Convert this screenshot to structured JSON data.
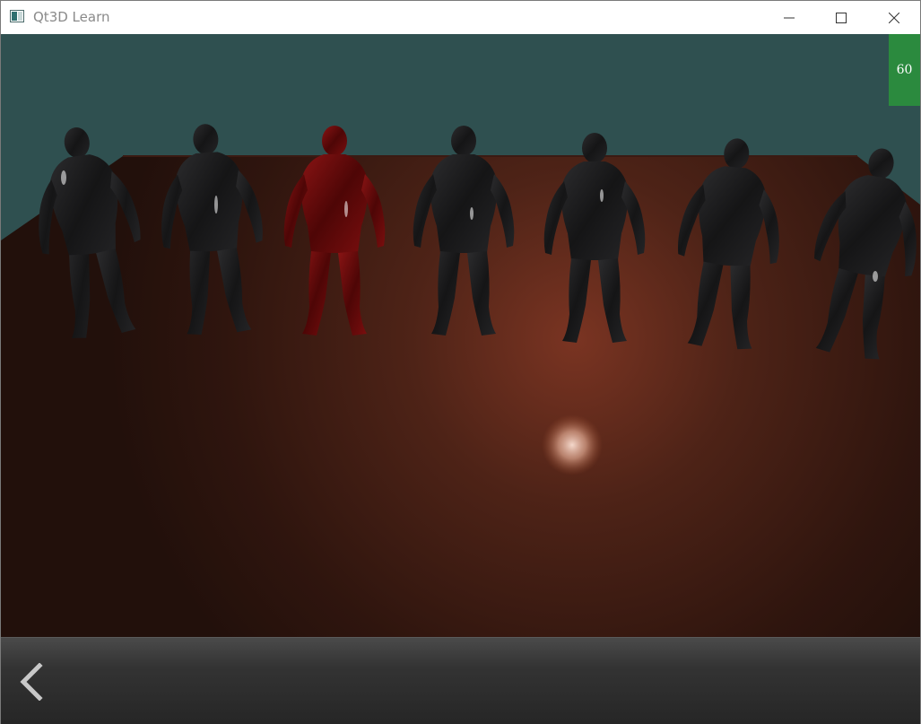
{
  "window": {
    "title": "Qt3D Learn",
    "app_icon": "qt-window-icon",
    "controls": {
      "minimize_icon": "minimize-icon",
      "maximize_icon": "maximize-icon",
      "close_icon": "close-icon"
    }
  },
  "viewport": {
    "fps": "60",
    "background_color": "#2f5050",
    "floor_color": "#4a2418",
    "highlight_color": "#b04a30",
    "figures": [
      {
        "name": "figure-1",
        "color": "#1c1c1e"
      },
      {
        "name": "figure-2",
        "color": "#1c1c1e"
      },
      {
        "name": "figure-3",
        "color": "#6a0a0a"
      },
      {
        "name": "figure-4",
        "color": "#1c1c1e"
      },
      {
        "name": "figure-5",
        "color": "#1c1c1e"
      },
      {
        "name": "figure-6",
        "color": "#1c1c1e"
      },
      {
        "name": "figure-7",
        "color": "#1c1c1e"
      }
    ]
  },
  "bottom_bar": {
    "back_icon": "chevron-left-icon"
  }
}
